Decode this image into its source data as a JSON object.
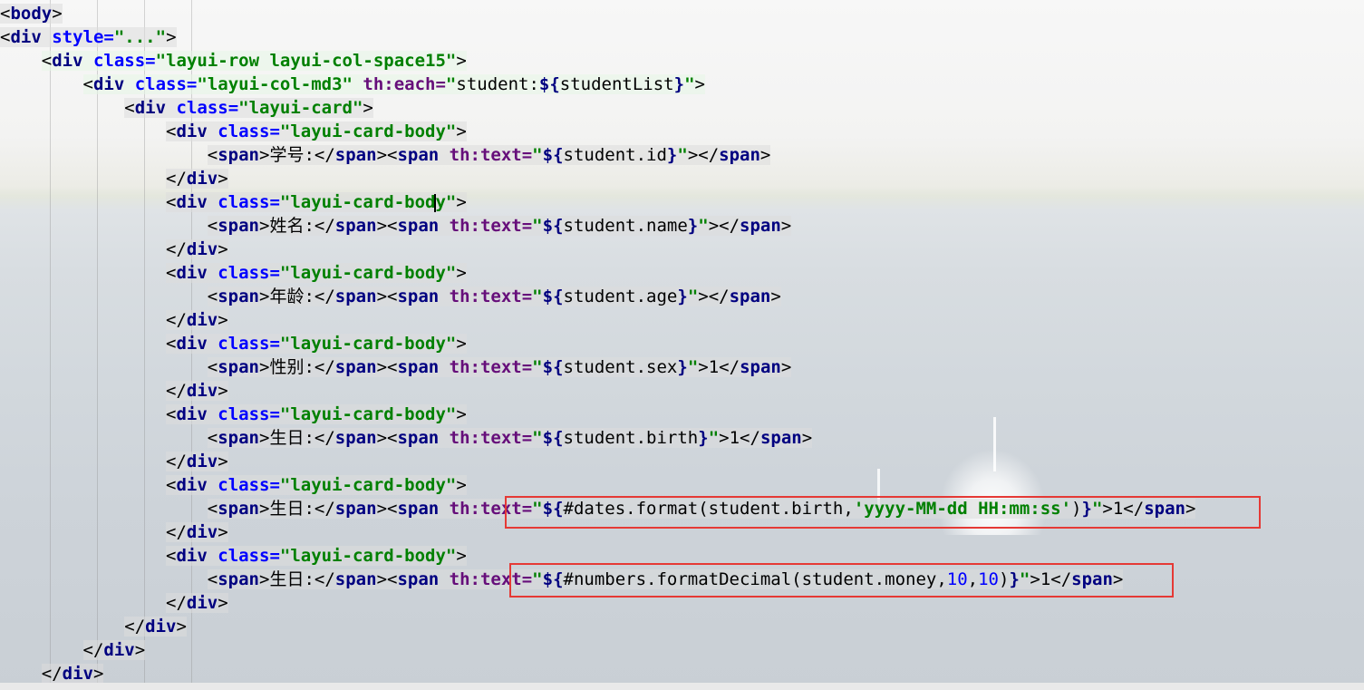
{
  "lines": [
    {
      "indent": "",
      "parts": [
        [
          "br",
          "<"
        ],
        [
          "tg",
          "body"
        ],
        [
          "br",
          ">"
        ]
      ]
    },
    {
      "indent": "",
      "parts": [
        [
          "br",
          "<"
        ],
        [
          "tg",
          "div "
        ],
        [
          "at",
          "style="
        ],
        [
          "st",
          "\"...\""
        ],
        [
          "br",
          ">"
        ]
      ]
    },
    {
      "indent": "    ",
      "parts": [
        [
          "br",
          "<"
        ],
        [
          "tg",
          "div "
        ],
        [
          "at",
          "class="
        ],
        [
          "st",
          "\"layui-row layui-col-space15\""
        ],
        [
          "br",
          ">"
        ]
      ]
    },
    {
      "indent": "        ",
      "parts": [
        [
          "br",
          "<"
        ],
        [
          "tg",
          "div "
        ],
        [
          "at",
          "class="
        ],
        [
          "st",
          "\"layui-col-md3\" "
        ],
        [
          "th",
          "th:each="
        ],
        [
          "st",
          "\""
        ],
        [
          "ex",
          "student:"
        ],
        [
          "tg",
          "${"
        ],
        [
          "ex",
          "studentList"
        ],
        [
          "tg",
          "}"
        ],
        [
          "st",
          "\""
        ],
        [
          "br",
          ">"
        ]
      ]
    },
    {
      "indent": "            ",
      "parts": [
        [
          "br",
          "<"
        ],
        [
          "tg",
          "div "
        ],
        [
          "at",
          "class="
        ],
        [
          "st",
          "\"layui-card\""
        ],
        [
          "br",
          ">"
        ]
      ]
    },
    {
      "indent": "                ",
      "parts": [
        [
          "br",
          "<"
        ],
        [
          "tg",
          "div "
        ],
        [
          "at",
          "class="
        ],
        [
          "st",
          "\"layui-card-body\""
        ],
        [
          "br",
          ">"
        ]
      ]
    },
    {
      "indent": "                    ",
      "parts": [
        [
          "br",
          "<"
        ],
        [
          "tg",
          "span"
        ],
        [
          "br",
          ">"
        ],
        [
          "ex",
          "学号:"
        ],
        [
          "br",
          "</"
        ],
        [
          "tg",
          "span"
        ],
        [
          "br",
          "><"
        ],
        [
          "tg",
          "span "
        ],
        [
          "th",
          "th:text="
        ],
        [
          "st",
          "\""
        ],
        [
          "tg",
          "${"
        ],
        [
          "ex",
          "student.id"
        ],
        [
          "tg",
          "}"
        ],
        [
          "st",
          "\""
        ],
        [
          "br",
          "></"
        ],
        [
          "tg",
          "span"
        ],
        [
          "br",
          ">"
        ]
      ]
    },
    {
      "indent": "                ",
      "parts": [
        [
          "br",
          "</"
        ],
        [
          "tg",
          "div"
        ],
        [
          "br",
          ">"
        ]
      ]
    },
    {
      "indent": "                ",
      "parts": [
        [
          "br",
          "<"
        ],
        [
          "tg",
          "div "
        ],
        [
          "at",
          "class="
        ],
        [
          "st",
          "\"layui-card-body\""
        ],
        [
          "br",
          ">"
        ]
      ]
    },
    {
      "indent": "                    ",
      "parts": [
        [
          "br",
          "<"
        ],
        [
          "tg",
          "span"
        ],
        [
          "br",
          ">"
        ],
        [
          "ex",
          "姓名:"
        ],
        [
          "br",
          "</"
        ],
        [
          "tg",
          "span"
        ],
        [
          "br",
          "><"
        ],
        [
          "tg",
          "span "
        ],
        [
          "th",
          "th:text="
        ],
        [
          "st",
          "\""
        ],
        [
          "tg",
          "${"
        ],
        [
          "ex",
          "student.name"
        ],
        [
          "tg",
          "}"
        ],
        [
          "st",
          "\""
        ],
        [
          "br",
          "></"
        ],
        [
          "tg",
          "span"
        ],
        [
          "br",
          ">"
        ]
      ]
    },
    {
      "indent": "                ",
      "parts": [
        [
          "br",
          "</"
        ],
        [
          "tg",
          "div"
        ],
        [
          "br",
          ">"
        ]
      ]
    },
    {
      "indent": "                ",
      "parts": [
        [
          "br",
          "<"
        ],
        [
          "tg",
          "div "
        ],
        [
          "at",
          "class="
        ],
        [
          "st",
          "\"layui-card-body\""
        ],
        [
          "br",
          ">"
        ]
      ]
    },
    {
      "indent": "                    ",
      "parts": [
        [
          "br",
          "<"
        ],
        [
          "tg",
          "span"
        ],
        [
          "br",
          ">"
        ],
        [
          "ex",
          "年龄:"
        ],
        [
          "br",
          "</"
        ],
        [
          "tg",
          "span"
        ],
        [
          "br",
          "><"
        ],
        [
          "tg",
          "span "
        ],
        [
          "th",
          "th:text="
        ],
        [
          "st",
          "\""
        ],
        [
          "tg",
          "${"
        ],
        [
          "ex",
          "student.age"
        ],
        [
          "tg",
          "}"
        ],
        [
          "st",
          "\""
        ],
        [
          "br",
          "></"
        ],
        [
          "tg",
          "span"
        ],
        [
          "br",
          ">"
        ]
      ]
    },
    {
      "indent": "                ",
      "parts": [
        [
          "br",
          "</"
        ],
        [
          "tg",
          "div"
        ],
        [
          "br",
          ">"
        ]
      ]
    },
    {
      "indent": "                ",
      "parts": [
        [
          "br",
          "<"
        ],
        [
          "tg",
          "div "
        ],
        [
          "at",
          "class="
        ],
        [
          "st",
          "\"layui-card-body\""
        ],
        [
          "br",
          ">"
        ]
      ]
    },
    {
      "indent": "                    ",
      "parts": [
        [
          "br",
          "<"
        ],
        [
          "tg",
          "span"
        ],
        [
          "br",
          ">"
        ],
        [
          "ex",
          "性别:"
        ],
        [
          "br",
          "</"
        ],
        [
          "tg",
          "span"
        ],
        [
          "br",
          "><"
        ],
        [
          "tg",
          "span "
        ],
        [
          "th",
          "th:text="
        ],
        [
          "st",
          "\""
        ],
        [
          "tg",
          "${"
        ],
        [
          "ex",
          "student.sex"
        ],
        [
          "tg",
          "}"
        ],
        [
          "st",
          "\""
        ],
        [
          "br",
          ">"
        ],
        [
          "ex",
          "1"
        ],
        [
          "br",
          "</"
        ],
        [
          "tg",
          "span"
        ],
        [
          "br",
          ">"
        ]
      ]
    },
    {
      "indent": "                ",
      "parts": [
        [
          "br",
          "</"
        ],
        [
          "tg",
          "div"
        ],
        [
          "br",
          ">"
        ]
      ]
    },
    {
      "indent": "                ",
      "parts": [
        [
          "br",
          "<"
        ],
        [
          "tg",
          "div "
        ],
        [
          "at",
          "class="
        ],
        [
          "st",
          "\"layui-card-body\""
        ],
        [
          "br",
          ">"
        ]
      ]
    },
    {
      "indent": "                    ",
      "parts": [
        [
          "br",
          "<"
        ],
        [
          "tg",
          "span"
        ],
        [
          "br",
          ">"
        ],
        [
          "ex",
          "生日:"
        ],
        [
          "br",
          "</"
        ],
        [
          "tg",
          "span"
        ],
        [
          "br",
          "><"
        ],
        [
          "tg",
          "span "
        ],
        [
          "th",
          "th:text="
        ],
        [
          "st",
          "\""
        ],
        [
          "tg",
          "${"
        ],
        [
          "ex",
          "student.birth"
        ],
        [
          "tg",
          "}"
        ],
        [
          "st",
          "\""
        ],
        [
          "br",
          ">"
        ],
        [
          "ex",
          "1"
        ],
        [
          "br",
          "</"
        ],
        [
          "tg",
          "span"
        ],
        [
          "br",
          ">"
        ]
      ]
    },
    {
      "indent": "                ",
      "parts": [
        [
          "br",
          "</"
        ],
        [
          "tg",
          "div"
        ],
        [
          "br",
          ">"
        ]
      ]
    },
    {
      "indent": "                ",
      "parts": [
        [
          "br",
          "<"
        ],
        [
          "tg",
          "div "
        ],
        [
          "at",
          "class="
        ],
        [
          "st",
          "\"layui-card-body\""
        ],
        [
          "br",
          ">"
        ]
      ]
    },
    {
      "indent": "                    ",
      "parts": [
        [
          "br",
          "<"
        ],
        [
          "tg",
          "span"
        ],
        [
          "br",
          ">"
        ],
        [
          "ex",
          "生日:"
        ],
        [
          "br",
          "</"
        ],
        [
          "tg",
          "span"
        ],
        [
          "br",
          "><"
        ],
        [
          "tg",
          "span "
        ],
        [
          "th",
          "th:text="
        ],
        [
          "st",
          "\""
        ],
        [
          "tg",
          "${"
        ],
        [
          "ex",
          "#dates.format(student.birth,"
        ],
        [
          "st",
          "'yyyy-MM-dd HH:mm:ss'"
        ],
        [
          "ex",
          ")"
        ],
        [
          "tg",
          "}"
        ],
        [
          "st",
          "\""
        ],
        [
          "br",
          ">"
        ],
        [
          "ex",
          "1"
        ],
        [
          "br",
          "</"
        ],
        [
          "tg",
          "span"
        ],
        [
          "br",
          ">"
        ]
      ]
    },
    {
      "indent": "                ",
      "parts": [
        [
          "br",
          "</"
        ],
        [
          "tg",
          "div"
        ],
        [
          "br",
          ">"
        ]
      ]
    },
    {
      "indent": "                ",
      "parts": [
        [
          "br",
          "<"
        ],
        [
          "tg",
          "div "
        ],
        [
          "at",
          "class="
        ],
        [
          "st",
          "\"layui-card-body\""
        ],
        [
          "br",
          ">"
        ]
      ]
    },
    {
      "indent": "                    ",
      "parts": [
        [
          "br",
          "<"
        ],
        [
          "tg",
          "span"
        ],
        [
          "br",
          ">"
        ],
        [
          "ex",
          "生日:"
        ],
        [
          "br",
          "</"
        ],
        [
          "tg",
          "span"
        ],
        [
          "br",
          "><"
        ],
        [
          "tg",
          "span "
        ],
        [
          "th",
          "th:text="
        ],
        [
          "st",
          "\""
        ],
        [
          "tg",
          "${"
        ],
        [
          "ex",
          "#numbers.formatDecimal(student.money,"
        ],
        [
          "nm",
          "10"
        ],
        [
          "ex",
          ","
        ],
        [
          "nm",
          "10"
        ],
        [
          "ex",
          ")"
        ],
        [
          "tg",
          "}"
        ],
        [
          "st",
          "\""
        ],
        [
          "br",
          ">"
        ],
        [
          "ex",
          "1"
        ],
        [
          "br",
          "</"
        ],
        [
          "tg",
          "span"
        ],
        [
          "br",
          ">"
        ]
      ]
    },
    {
      "indent": "                ",
      "parts": [
        [
          "br",
          "</"
        ],
        [
          "tg",
          "div"
        ],
        [
          "br",
          ">"
        ]
      ]
    },
    {
      "indent": "            ",
      "parts": [
        [
          "br",
          "</"
        ],
        [
          "tg",
          "div"
        ],
        [
          "br",
          ">"
        ]
      ]
    },
    {
      "indent": "        ",
      "parts": [
        [
          "br",
          "</"
        ],
        [
          "tg",
          "div"
        ],
        [
          "br",
          ">"
        ]
      ]
    },
    {
      "indent": "    ",
      "parts": [
        [
          "br",
          "</"
        ],
        [
          "tg",
          "div"
        ],
        [
          "br",
          ">"
        ]
      ]
    }
  ],
  "cursor": {
    "line": 8,
    "text_before": "<div class=\"layui-card-bod",
    "text_after": "y\">"
  },
  "colors": {
    "tag": "#000080",
    "attr": "#0000ff",
    "th_attr": "#660e7a",
    "string": "#008000",
    "number": "#0000ff",
    "highlight": "#e53935"
  }
}
